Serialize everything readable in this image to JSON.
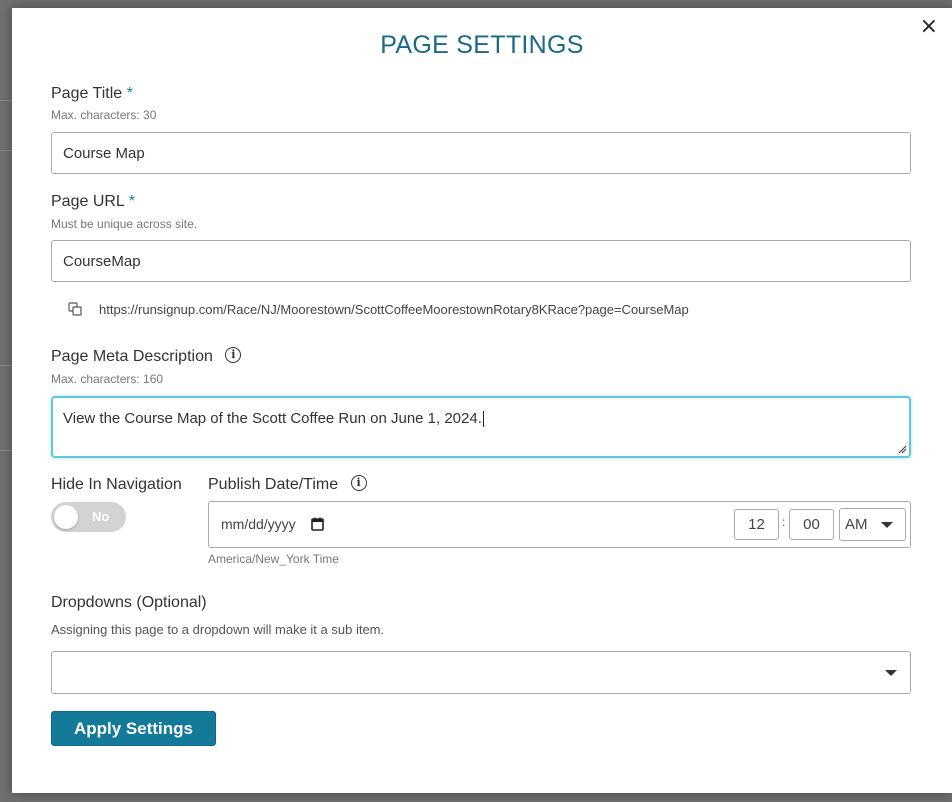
{
  "modal": {
    "title": "PAGE SETTINGS",
    "close_symbol": "×"
  },
  "page_title": {
    "label": "Page Title",
    "required_mark": "*",
    "hint": "Max. characters: 30",
    "value": "Course Map"
  },
  "page_url": {
    "label": "Page URL",
    "required_mark": "*",
    "hint": "Must be unique across site.",
    "value": "CourseMap",
    "full_url": "https://runsignup.com/Race/NJ/Moorestown/ScottCoffeeMoorestownRotary8KRace?page=CourseMap"
  },
  "meta_description": {
    "label": "Page Meta Description",
    "hint": "Max. characters: 160",
    "value": "View the Course Map of the Scott Coffee Run on June 1, 2024."
  },
  "hide_in_navigation": {
    "label": "Hide In Navigation",
    "state_text": "No",
    "enabled": false
  },
  "publish": {
    "label": "Publish Date/Time",
    "date_placeholder": "mm/dd/yyyy",
    "hour": "12",
    "separator": ":",
    "minute": "00",
    "ampm": "AM",
    "timezone": "America/New_York Time"
  },
  "dropdowns": {
    "label": "Dropdowns (Optional)",
    "hint": "Assigning this page to a dropdown will make it a sub item.",
    "selected": ""
  },
  "apply_button": "Apply Settings",
  "colors": {
    "title": "#1a6a86",
    "required": "#1a7fa3",
    "focus_border": "#63c6dc",
    "primary_button": "#137a99",
    "toggle_off": "#d3d3d3"
  },
  "icons": [
    "close-icon",
    "copy-icon",
    "info-icon",
    "calendar-icon",
    "chevron-down-icon",
    "resize-handle-icon"
  ]
}
